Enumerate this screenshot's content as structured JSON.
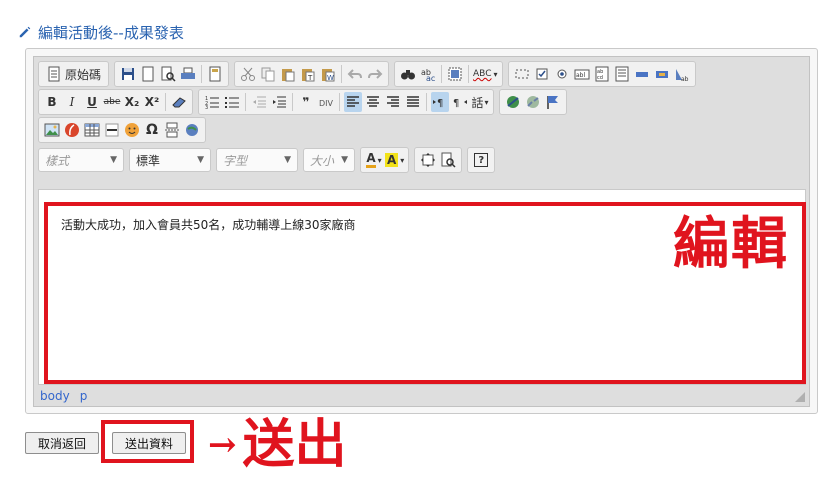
{
  "section": {
    "title": "編輯活動後--成果發表",
    "icon": "pencil-icon"
  },
  "toolbar": {
    "row1": {
      "source_label": "原始碼",
      "spellcheck_label": "ABC"
    },
    "row2": {
      "bold": "B",
      "italic": "I",
      "underline": "U",
      "strike": "abe",
      "subscript": "X₂",
      "superscript": "X²",
      "quote": "❞",
      "language": "話"
    },
    "row4": {
      "style_placeholder": "樣式",
      "format_value": "標準",
      "font_placeholder": "字型",
      "size_placeholder": "大小",
      "text_color_glyph": "A",
      "bg_color_glyph": "A",
      "help_glyph": "?"
    }
  },
  "editor": {
    "content": "活動大成功，加入會員共50名，成功輔導上線30家廠商",
    "annotation": "編輯",
    "status_path": [
      "body",
      "p"
    ]
  },
  "buttons": {
    "cancel": "取消返回",
    "submit": "送出資料"
  },
  "annotation_submit": {
    "arrow": "→",
    "text": "送出"
  },
  "colors": {
    "accent": "#2a63b0",
    "annotation_red": "#e0141e",
    "toolbar_bg": "#dedede"
  }
}
